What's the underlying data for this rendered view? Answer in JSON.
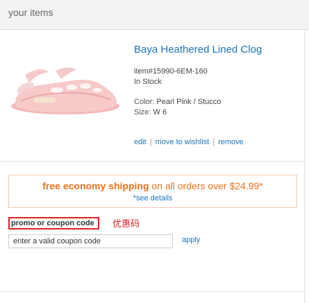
{
  "header": {
    "title": "your items"
  },
  "item": {
    "name": "Baya Heathered Lined Clog",
    "item_number": "item#15990-6EM-160",
    "stock": "In Stock",
    "color_label": "Color:",
    "color_value": "Pearl Pink / Stucco",
    "size_label": "Size:",
    "size_value": "W 6",
    "image_icon": "pink-clog-product-image",
    "actions": {
      "edit": "edit",
      "wishlist": "move to wishlist",
      "remove": "remove",
      "separator": "|"
    }
  },
  "promo_banner": {
    "highlight": "free economy shipping",
    "rest": " on all orders over $24.99*",
    "details_link": "*see details",
    "highlight_color": "#e8711d"
  },
  "coupon": {
    "label": "promo or coupon code",
    "annotation": "优惠码",
    "input_value": "enter a valid coupon code",
    "apply_label": "apply"
  },
  "colors": {
    "link": "#1f73b7",
    "accent": "#e8711d",
    "annotation": "#dd2222"
  }
}
